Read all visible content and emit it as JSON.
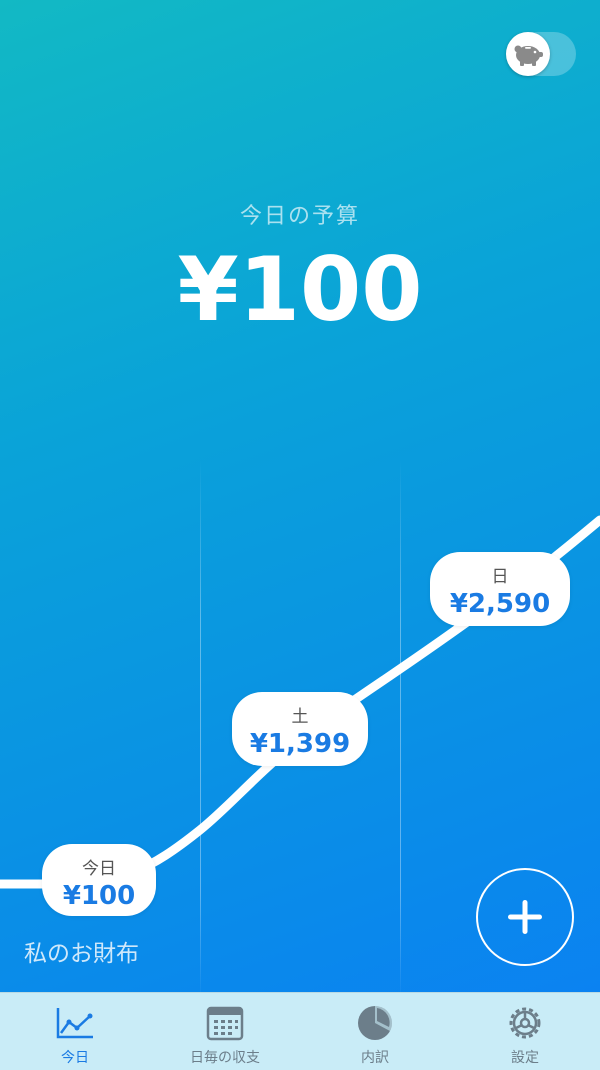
{
  "header": {
    "savings_toggle": {
      "icon": "piggy-bank-icon",
      "on": true
    }
  },
  "budget": {
    "label": "今日の予算",
    "amount": "¥100"
  },
  "chart_data": {
    "type": "line",
    "x": [
      "今日",
      "土",
      "日"
    ],
    "labels": [
      "¥100",
      "¥1,399",
      "¥2,590"
    ],
    "values": [
      100,
      1399,
      2590
    ],
    "title": "",
    "xlabel": "",
    "ylabel": ""
  },
  "wallet": {
    "name": "私のお財布"
  },
  "fab": {
    "icon": "plus-icon"
  },
  "tabbar": {
    "tabs": [
      {
        "label": "今日",
        "icon": "line-chart-icon",
        "active": true
      },
      {
        "label": "日毎の収支",
        "icon": "calendar-icon",
        "active": false
      },
      {
        "label": "内訳",
        "icon": "pie-chart-icon",
        "active": false
      },
      {
        "label": "設定",
        "icon": "gear-icon",
        "active": false
      }
    ]
  },
  "colors": {
    "accent": "#1a7be3",
    "tab_bg": "#c9ecf7",
    "inactive": "#6c7e8a"
  }
}
